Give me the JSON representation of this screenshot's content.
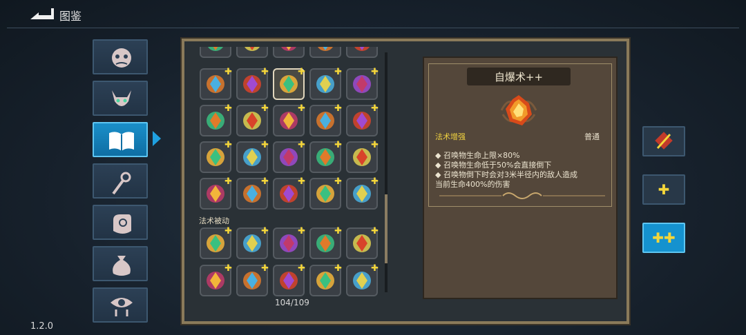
{
  "header": {
    "title": "图鉴",
    "back_icon": "back-arrow-icon"
  },
  "version": "1.2.0",
  "categories": [
    {
      "icon": "monster-face-icon",
      "active": false
    },
    {
      "icon": "horned-demon-icon",
      "active": false
    },
    {
      "icon": "open-book-icon",
      "active": true
    },
    {
      "icon": "staff-icon",
      "active": false
    },
    {
      "icon": "hand-swirl-icon",
      "active": false
    },
    {
      "icon": "sack-icon",
      "active": false
    },
    {
      "icon": "dripping-eye-icon",
      "active": false
    }
  ],
  "grid": {
    "section_label": "法术被动",
    "counter": "104/109",
    "rows_active": [
      [
        "water-figure-icon",
        "red-flower-icon",
        "explosion-icon",
        "red-spike-icon",
        "golden-rune-icon"
      ],
      [
        "yellow-bolt-icon",
        "blue-ghost-icon",
        "green-arc-icon",
        "blue-orb-icon",
        "double-arrow-icon"
      ],
      [
        "golden-eye-icon",
        "blue-swirl-icon",
        "purple-clock-icon",
        "target-ring-icon",
        "orange-blade-icon"
      ],
      [
        "arrow-strike-icon",
        "red-burst-icon",
        "crossed-swords-icon",
        "golden-ring-icon",
        "red-claw-icon"
      ]
    ],
    "rows_passive": [
      [
        "red-chest-icon",
        "red-mask-icon",
        "hex-gem-icon",
        "spirit-figure-icon",
        "hourglass-icon"
      ],
      [
        "red-rock-icon",
        "flame-diamond-icon",
        "signal-icon",
        "triple-dots-icon",
        "green-orb-icon"
      ]
    ]
  },
  "detail": {
    "title": "自爆术++",
    "icon": "explosion-icon",
    "tag_left": "法术增强",
    "tag_right": "普通",
    "description": [
      "◆ 召唤物生命上限×80%",
      "◆ 召唤物生命低于50%会直接倒下",
      "◆ 召唤物倒下时会对3米半径内的敌人造成",
      "当前生命400%的伤害"
    ]
  },
  "side_buttons": [
    {
      "glyph": "⧸",
      "icon": "slash-icon",
      "active": false
    },
    {
      "glyph": "✚",
      "icon": "single-plus-icon",
      "active": false
    },
    {
      "glyph": "✚✚",
      "icon": "double-plus-icon",
      "active": true
    }
  ],
  "colors": {
    "accent": "#1592cf",
    "frame": "#8a7a5a",
    "plus": "#f4d63a"
  }
}
